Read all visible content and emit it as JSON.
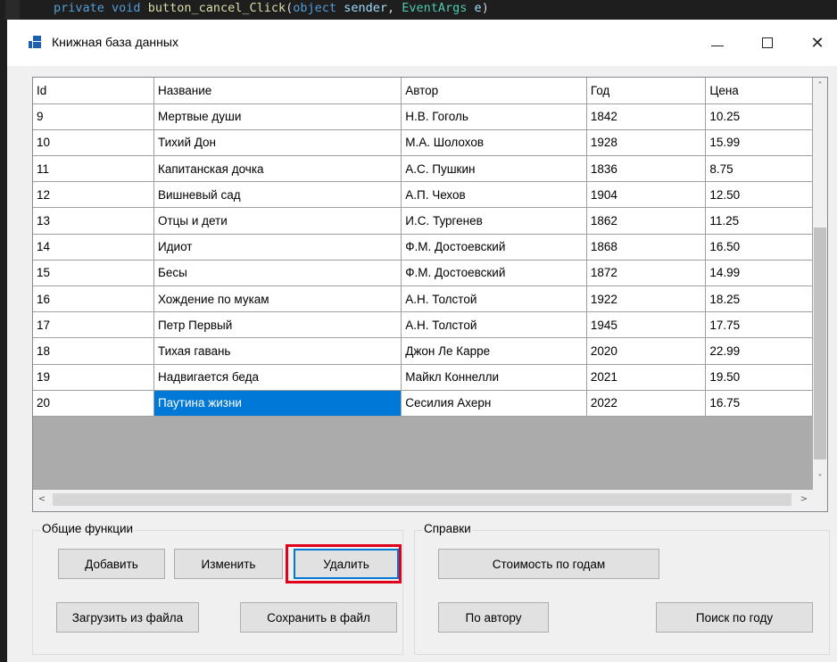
{
  "editor": {
    "code_tokens": [
      "private",
      "void",
      "button_cancel_Click",
      "(",
      "object",
      "sender",
      ", ",
      "EventArgs",
      "e",
      ")"
    ]
  },
  "window": {
    "title": "Книжная база данных",
    "controls": {
      "minimize": "—",
      "maximize": "☐",
      "close": "✕"
    }
  },
  "grid": {
    "columns": [
      "Id",
      "Название",
      "Автор",
      "Год",
      "Цена"
    ],
    "rows": [
      [
        "9",
        "Мертвые души",
        "Н.В. Гоголь",
        "1842",
        "10.25"
      ],
      [
        "10",
        "Тихий Дон",
        "М.А. Шолохов",
        "1928",
        "15.99"
      ],
      [
        "11",
        "Капитанская дочка",
        "А.С. Пушкин",
        "1836",
        "8.75"
      ],
      [
        "12",
        "Вишневый сад",
        "А.П. Чехов",
        "1904",
        "12.50"
      ],
      [
        "13",
        "Отцы и дети",
        "И.С. Тургенев",
        "1862",
        "11.25"
      ],
      [
        "14",
        "Идиот",
        "Ф.М. Достоевский",
        "1868",
        "16.50"
      ],
      [
        "15",
        "Бесы",
        "Ф.М. Достоевский",
        "1872",
        "14.99"
      ],
      [
        "16",
        "Хождение по мукам",
        "А.Н. Толстой",
        "1922",
        "18.25"
      ],
      [
        "17",
        "Петр Первый",
        "А.Н. Толстой",
        "1945",
        "17.75"
      ],
      [
        "18",
        "Тихая гавань",
        "Джон Ле Карре",
        "2020",
        "22.99"
      ],
      [
        "19",
        "Надвигается беда",
        "Майкл Коннелли",
        "2021",
        "19.50"
      ],
      [
        "20",
        "Паутина жизни",
        "Сесилия Ахерн",
        "2022",
        "16.75"
      ]
    ],
    "selected_cell": {
      "row": 11,
      "col": 1
    },
    "selection_color": "#0078d7"
  },
  "groups": {
    "general": {
      "title": "Общие функции",
      "add": "Добавить",
      "edit": "Изменить",
      "delete": "Удалить",
      "load": "Загрузить из файла",
      "save": "Сохранить в файл"
    },
    "reports": {
      "title": "Справки",
      "cost_by_years": "Стоимость по годам",
      "by_author": "По автору",
      "search_by_year": "Поиск по году"
    }
  },
  "highlight_color": "#e0001b"
}
